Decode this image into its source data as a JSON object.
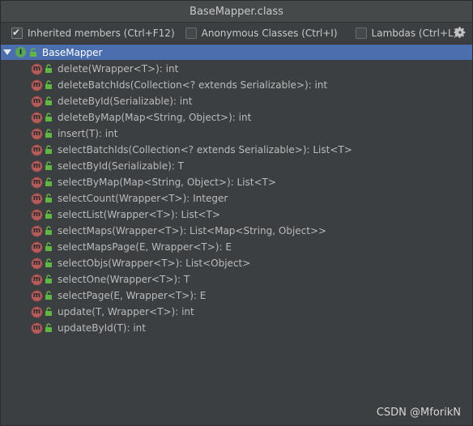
{
  "window": {
    "title": "BaseMapper.class"
  },
  "options": {
    "inherited_members": {
      "label": "Inherited members (Ctrl+F12)",
      "checked": true
    },
    "anonymous_classes": {
      "label": "Anonymous Classes (Ctrl+I)",
      "checked": false
    },
    "lambdas": {
      "label": "Lambdas (Ctrl+L)",
      "checked": false
    }
  },
  "tree": {
    "root": {
      "label": "BaseMapper",
      "icon": "interface-icon",
      "expanded": true
    },
    "members": [
      {
        "label": "delete(Wrapper<T>): int"
      },
      {
        "label": "deleteBatchIds(Collection<? extends Serializable>): int"
      },
      {
        "label": "deleteById(Serializable): int"
      },
      {
        "label": "deleteByMap(Map<String, Object>): int"
      },
      {
        "label": "insert(T): int"
      },
      {
        "label": "selectBatchIds(Collection<? extends Serializable>): List<T>"
      },
      {
        "label": "selectById(Serializable): T"
      },
      {
        "label": "selectByMap(Map<String, Object>): List<T>"
      },
      {
        "label": "selectCount(Wrapper<T>): Integer"
      },
      {
        "label": "selectList(Wrapper<T>): List<T>"
      },
      {
        "label": "selectMaps(Wrapper<T>): List<Map<String, Object>>"
      },
      {
        "label": "selectMapsPage(E, Wrapper<T>): E"
      },
      {
        "label": "selectObjs(Wrapper<T>): List<Object>"
      },
      {
        "label": "selectOne(Wrapper<T>): T"
      },
      {
        "label": "selectPage(E, Wrapper<T>): E"
      },
      {
        "label": "update(T, Wrapper<T>): int"
      },
      {
        "label": "updateById(T): int"
      }
    ]
  },
  "watermark": "CSDN @MforikN",
  "colors": {
    "background": "#3c3f41",
    "selection": "#4b6eaf",
    "method_icon": "#b35c5c",
    "interface_icon": "#5aa55a",
    "lock": "#62b543"
  }
}
